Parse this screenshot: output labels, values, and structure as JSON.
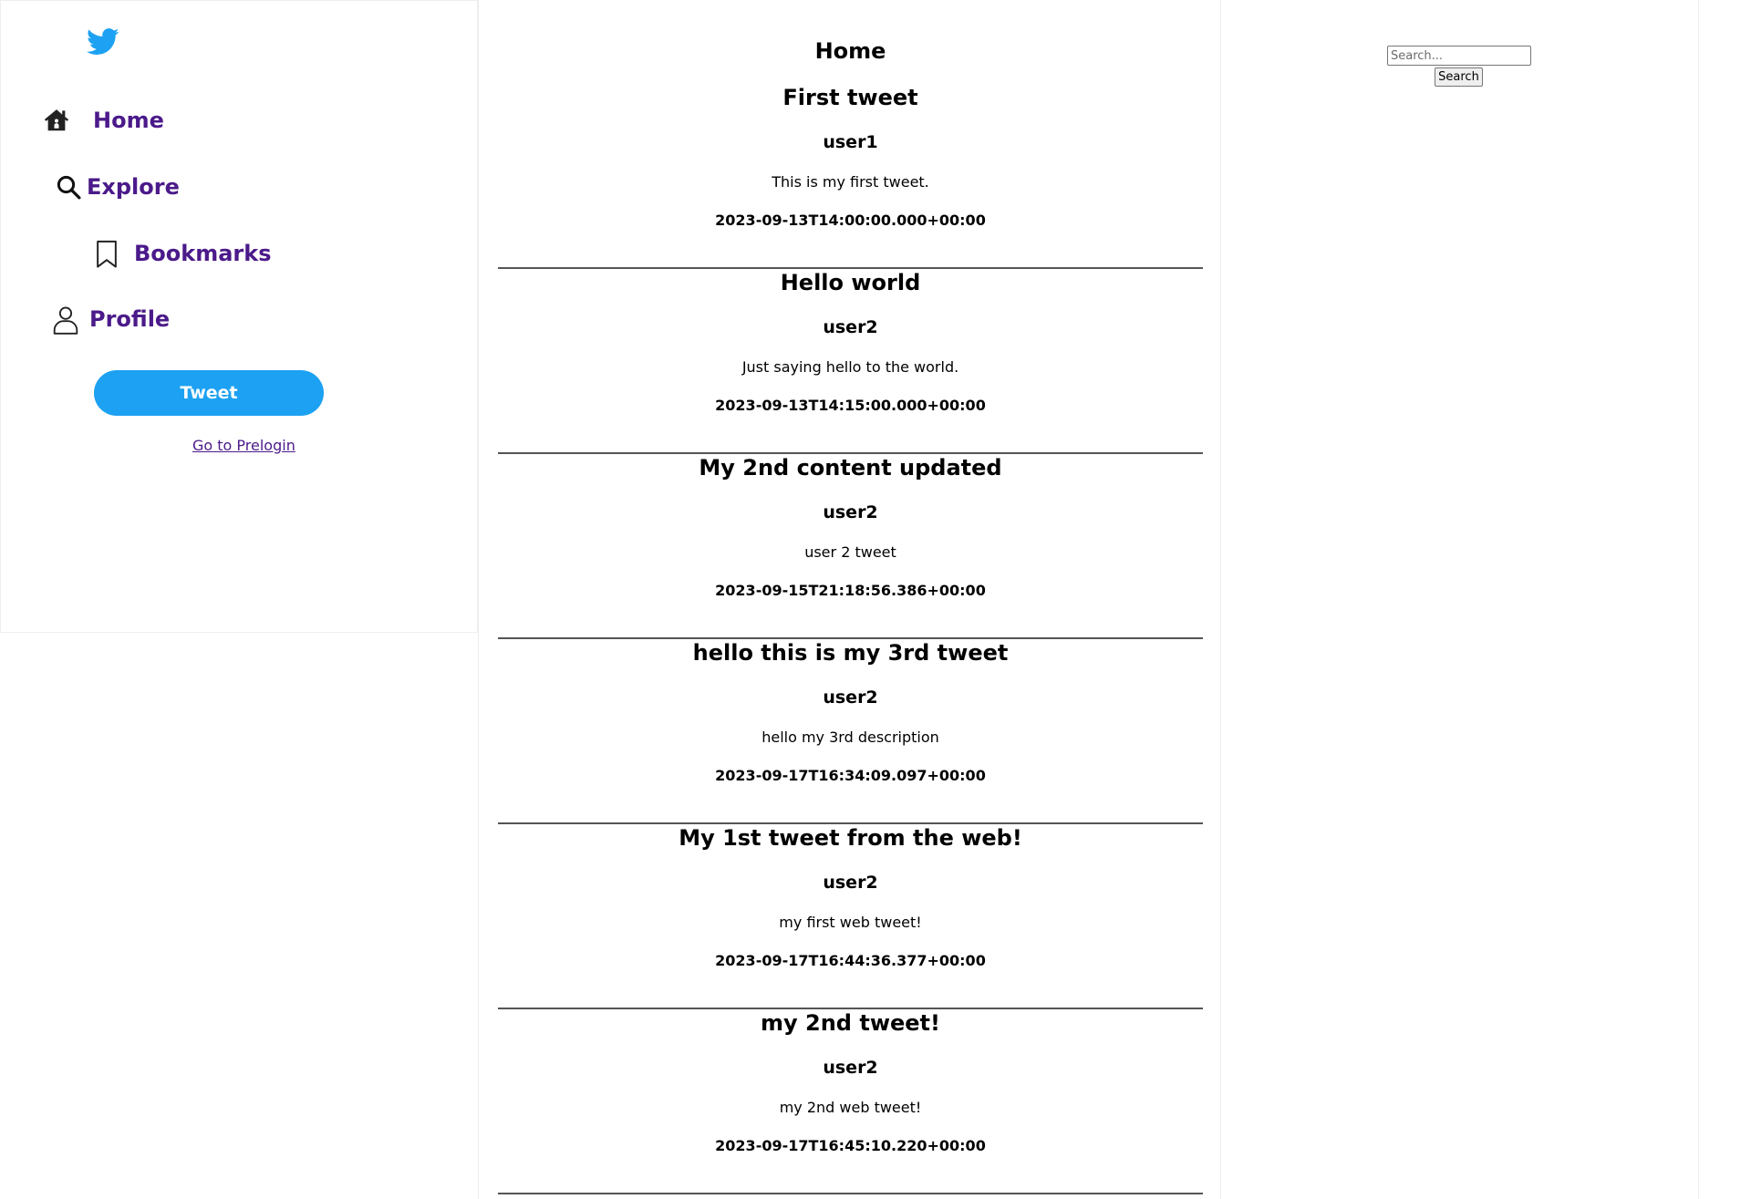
{
  "sidebar": {
    "logo_icon": "twitter-bird-icon",
    "brand_color": "#1da1f2",
    "nav_color": "#4b1a8a",
    "nav": [
      {
        "label": "Home",
        "icon": "home-icon"
      },
      {
        "label": "Explore",
        "icon": "search-icon"
      },
      {
        "label": "Bookmarks",
        "icon": "bookmark-icon"
      },
      {
        "label": "Profile",
        "icon": "user-icon"
      }
    ],
    "tweet_button": "Tweet",
    "prelogin_link": "Go to Prelogin"
  },
  "main": {
    "title": "Home",
    "tweets": [
      {
        "title": "First tweet",
        "user": "user1",
        "body": "This is my first tweet.",
        "timestamp": "2023-09-13T14:00:00.000+00:00"
      },
      {
        "title": "Hello world",
        "user": "user2",
        "body": "Just saying hello to the world.",
        "timestamp": "2023-09-13T14:15:00.000+00:00"
      },
      {
        "title": "My 2nd content updated",
        "user": "user2",
        "body": "user 2 tweet",
        "timestamp": "2023-09-15T21:18:56.386+00:00"
      },
      {
        "title": "hello this is my 3rd tweet",
        "user": "user2",
        "body": "hello my 3rd description",
        "timestamp": "2023-09-17T16:34:09.097+00:00"
      },
      {
        "title": "My 1st tweet from the web!",
        "user": "user2",
        "body": "my first web tweet!",
        "timestamp": "2023-09-17T16:44:36.377+00:00"
      },
      {
        "title": "my 2nd tweet!",
        "user": "user2",
        "body": "my 2nd web tweet!",
        "timestamp": "2023-09-17T16:45:10.220+00:00"
      }
    ]
  },
  "right": {
    "search_placeholder": "Search...",
    "search_value": "",
    "search_button": "Search"
  }
}
